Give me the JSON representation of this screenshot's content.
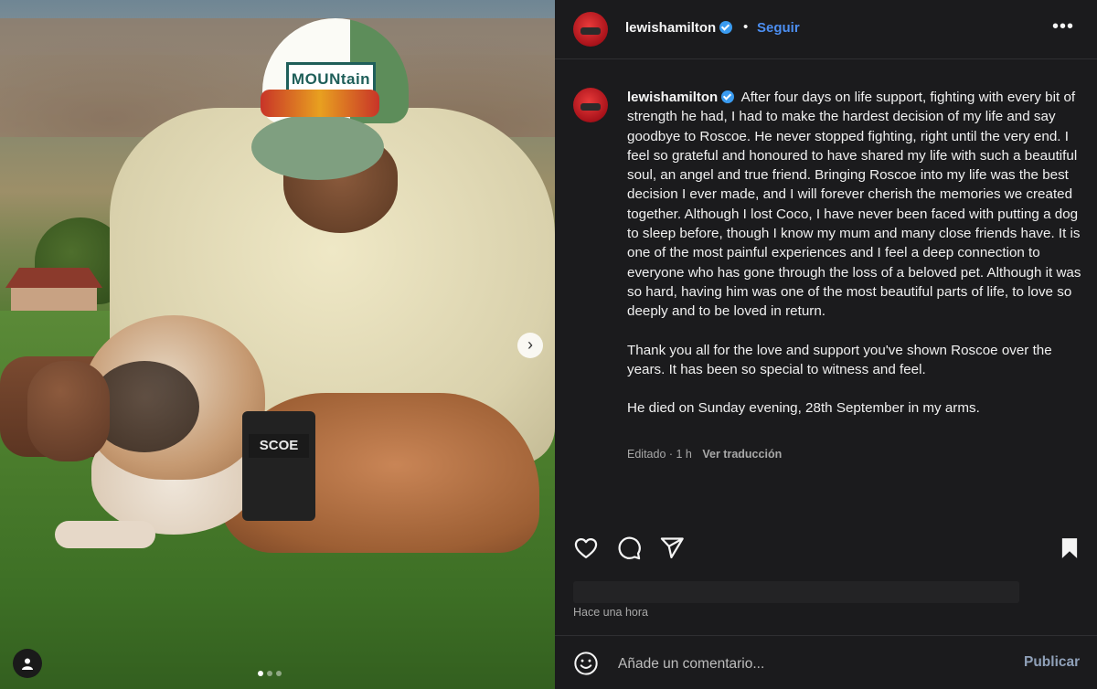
{
  "post": {
    "username": "lewishamilton",
    "follow_label": "Seguir",
    "separator": "•",
    "more_label": "•••",
    "caption_paragraphs": [
      "After four days on life support, fighting with every bit of strength he had, I had to make the hardest decision of my life and say goodbye to Roscoe. He never stopped fighting, right until the very end. I feel so grateful and honoured to have shared my life with such a beautiful soul, an angel and true friend. Bringing Roscoe into my life was the best decision I ever made, and I will forever cherish the memories we created together. Although I lost Coco, I have never been faced with putting a dog to sleep before, though I know my mum and many close friends have. It is one of the most painful experiences and I feel a deep connection to everyone who has gone through the loss of a beloved pet. Although it was so hard, having him was one of the most beautiful parts of life, to love so deeply and to be loved in return.",
      "Thank you all for the love and support you've shown Roscoe over the years. It has been so special to witness and feel.",
      "He died on Sunday evening, 28th September in my arms."
    ],
    "meta_edited": "Editado · 1 h",
    "translate_label": "Ver traducción",
    "time_ago": "Hace una hora"
  },
  "photo": {
    "cap_badge": "MOUNtain",
    "harness_label": "SCOE",
    "carousel": {
      "count": 3,
      "active_index": 0
    },
    "next_arrow": "›"
  },
  "comment": {
    "placeholder": "Añade un comentario...",
    "publish_label": "Publicar"
  },
  "colors": {
    "panel_bg": "#1b1b1d",
    "accent_blue": "#4c8ef0",
    "verified_blue": "#3a9bf0",
    "muted_text": "#a8a8a8"
  },
  "icons": [
    "heart-icon",
    "comment-icon",
    "share-icon",
    "bookmark-icon",
    "emoji-icon",
    "user-tag-icon",
    "verified-icon",
    "more-options-icon",
    "chevron-right-icon"
  ]
}
